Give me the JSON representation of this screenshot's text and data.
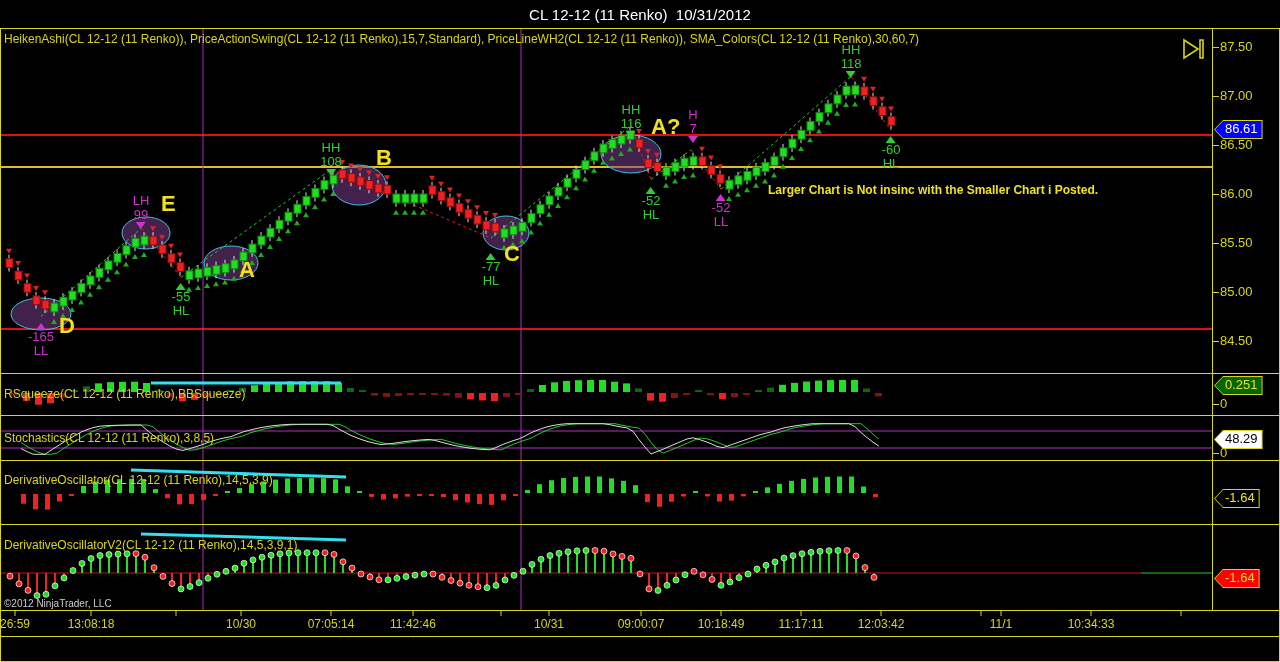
{
  "window": {
    "title": "CL 12-12 (11 Renko)  10/31/2012"
  },
  "price_panel": {
    "indicator_label": "HeikenAshi(CL 12-12 (11 Renko)), PriceActionSwing(CL 12-12 (11 Renko),15,7,Standard), PriceLineWH2(CL 12-12 (11 Renko)), SMA_Colors(CL 12-12 (11 Renko),30,60,7)",
    "price_ticks": [
      "87.50",
      "87.00",
      "86.50",
      "86.00",
      "85.50",
      "85.00",
      "84.50"
    ],
    "price_tag": {
      "text": "86.61",
      "color": "#0000ff"
    },
    "swings": [
      {
        "kind": "high",
        "color": "#33cc33",
        "label": "HH",
        "value": "118"
      },
      {
        "kind": "high",
        "color": "#33cc33",
        "label": "HH",
        "value": "108"
      },
      {
        "kind": "high",
        "color": "#33cc33",
        "label": "HH",
        "value": "116"
      },
      {
        "kind": "high",
        "color": "#cc33cc",
        "label": "LH",
        "value": "99"
      },
      {
        "kind": "high",
        "color": "#cc33cc",
        "label": "H",
        "value": "7"
      },
      {
        "kind": "low",
        "color": "#cc33cc",
        "label": "LL",
        "value": "-165"
      },
      {
        "kind": "low",
        "color": "#33cc33",
        "label": "HL",
        "value": "-55"
      },
      {
        "kind": "low",
        "color": "#33cc33",
        "label": "HL",
        "value": "-77"
      },
      {
        "kind": "low",
        "color": "#33cc33",
        "label": "HL",
        "value": "-52"
      },
      {
        "kind": "low",
        "color": "#cc33cc",
        "label": "LL",
        "value": "-52"
      },
      {
        "kind": "low",
        "color": "#33cc33",
        "label": "HL",
        "value": "-60"
      }
    ],
    "pattern_letters": [
      "D",
      "E",
      "A",
      "B",
      "C",
      "A?"
    ],
    "note": "Larger Chart is Not insinc with the Smaller Chart i Posted."
  },
  "indicator_panels": [
    {
      "kind": "squeeze",
      "label": "RSqueeze(CL 12-12 (11 Renko),BBSqueeze)",
      "tag": {
        "text": "0.251",
        "color": "#006600"
      },
      "ticks": [
        "0"
      ]
    },
    {
      "kind": "stochastics",
      "label": "Stochastics(CL 12-12 (11 Renko),3,8,5)",
      "tag": {
        "text": "48.29",
        "color": "#ffffff"
      },
      "ticks": [
        "0"
      ]
    },
    {
      "kind": "oscillator",
      "label": "DerivativeOscillator(CL 12-12 (11 Renko),14,5,3,9)",
      "tag": {
        "text": "-1.64",
        "color": "#000000"
      }
    },
    {
      "kind": "oscillator_dots",
      "label": "DerivativeOscillatorV2(CL 12-12 (11 Renko),14,5,3,9,1)",
      "tag": {
        "text": "-1.64",
        "color": "#ff0000"
      }
    }
  ],
  "time_axis": [
    "26:59",
    "13:08:18",
    "10/30",
    "07:05:14",
    "11:42:46",
    "10/31",
    "09:00:07",
    "10:18:49",
    "11:17:11",
    "12:03:42",
    "11/1",
    "10:34:33"
  ],
  "copyright": "©2012 NinjaTrader, LLC"
}
